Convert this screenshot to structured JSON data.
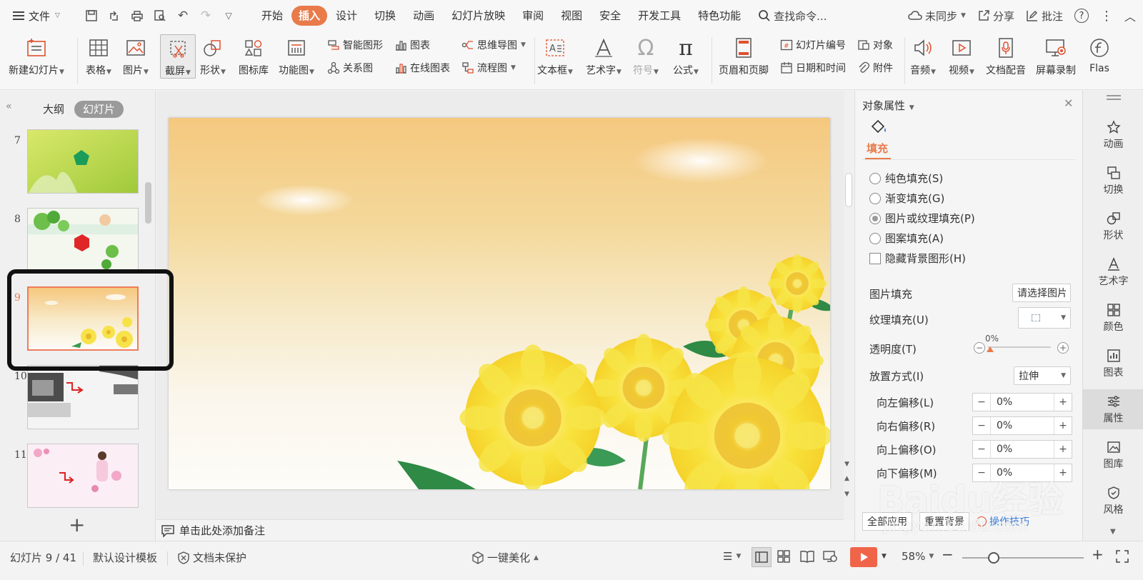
{
  "menu": {
    "file": "文件",
    "tabs": [
      "开始",
      "插入",
      "设计",
      "切换",
      "动画",
      "幻灯片放映",
      "审阅",
      "视图",
      "安全",
      "开发工具",
      "特色功能"
    ],
    "active_tab": "插入",
    "search": "查找命令...",
    "right": {
      "sync": "未同步",
      "share": "分享",
      "comment": "批注"
    }
  },
  "ribbon": {
    "new_slide": "新建幻灯片",
    "table": "表格",
    "picture": "图片",
    "screenshot": "截屏",
    "shape": "形状",
    "icon_lib": "图标库",
    "func_chart": "功能图",
    "smart_shape": "智能图形",
    "chart": "图表",
    "relation": "关系图",
    "online_chart": "在线图表",
    "mindmap": "思维导图",
    "flowchart": "流程图",
    "textbox": "文本框",
    "art_text": "艺术字",
    "symbol": "符号",
    "formula": "公式",
    "header_footer": "页眉和页脚",
    "slide_number": "幻灯片编号",
    "object": "对象",
    "date_time": "日期和时间",
    "attachment": "附件",
    "audio": "音频",
    "video": "视频",
    "doc_dub": "文档配音",
    "screen_rec": "屏幕录制",
    "flash": "Flas"
  },
  "left_panel": {
    "tab_outline": "大纲",
    "tab_slides": "幻灯片",
    "thumbs": [
      {
        "num": "7"
      },
      {
        "num": "8"
      },
      {
        "num": "9"
      },
      {
        "num": "10"
      },
      {
        "num": "11"
      }
    ],
    "add": "+"
  },
  "notes": "单击此处添加备注",
  "props": {
    "title": "对象属性",
    "tab_fill": "填充",
    "solid": "纯色填充(S)",
    "gradient": "渐变填充(G)",
    "picture_texture": "图片或纹理填充(P)",
    "pattern": "图案填充(A)",
    "hide_bg": "隐藏背景图形(H)",
    "selected_fill": "picture_texture",
    "pic_fill_label": "图片填充",
    "pic_fill_btn": "请选择图片",
    "texture_label": "纹理填充(U)",
    "transparency_label": "透明度(T)",
    "transparency_value": "0%",
    "placement_label": "放置方式(I)",
    "placement_value": "拉伸",
    "offsets": [
      {
        "label": "向左偏移(L)",
        "value": "0%"
      },
      {
        "label": "向右偏移(R)",
        "value": "0%"
      },
      {
        "label": "向上偏移(O)",
        "value": "0%"
      },
      {
        "label": "向下偏移(M)",
        "value": "0%"
      }
    ],
    "apply_all": "全部应用",
    "reset_bg": "重置背景",
    "tips": "操作技巧"
  },
  "right_sidebar": [
    "动画",
    "切换",
    "形状",
    "艺术字",
    "颜色",
    "图表",
    "属性",
    "图库",
    "风格"
  ],
  "status": {
    "slide_info": "幻灯片 9 / 41",
    "template": "默认设计模板",
    "protect": "文档未保护",
    "beautify": "一键美化",
    "zoom": "58%"
  },
  "watermark": {
    "main": "Baidu经验",
    "sub": "jingyan.baidu.com"
  },
  "colors": {
    "accent": "#e97b4a",
    "play": "#f0654a"
  }
}
